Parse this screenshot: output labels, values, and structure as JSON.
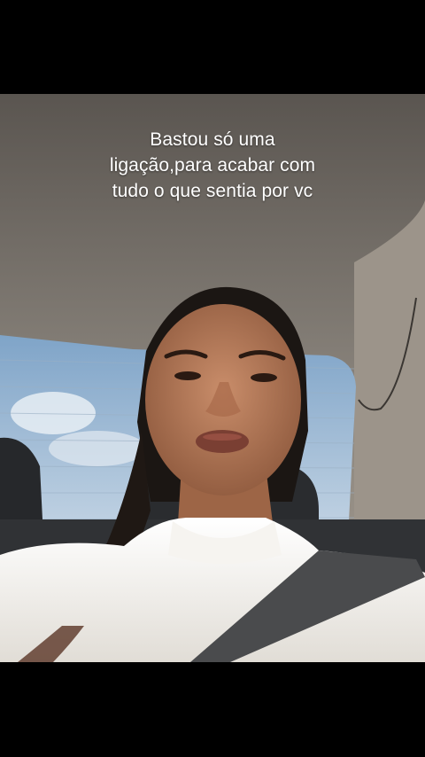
{
  "caption": {
    "lines": [
      "Bastou só uma",
      "ligação,para acabar com",
      "tudo o que sentia por vc"
    ]
  },
  "colors": {
    "letterbox": "#000000",
    "caption_text": "#ffffff",
    "car_ceiling": "#8a847c",
    "sky": "#9fbbd6",
    "shirt": "#f1efeb",
    "seatbelt": "#4a4b4d"
  }
}
